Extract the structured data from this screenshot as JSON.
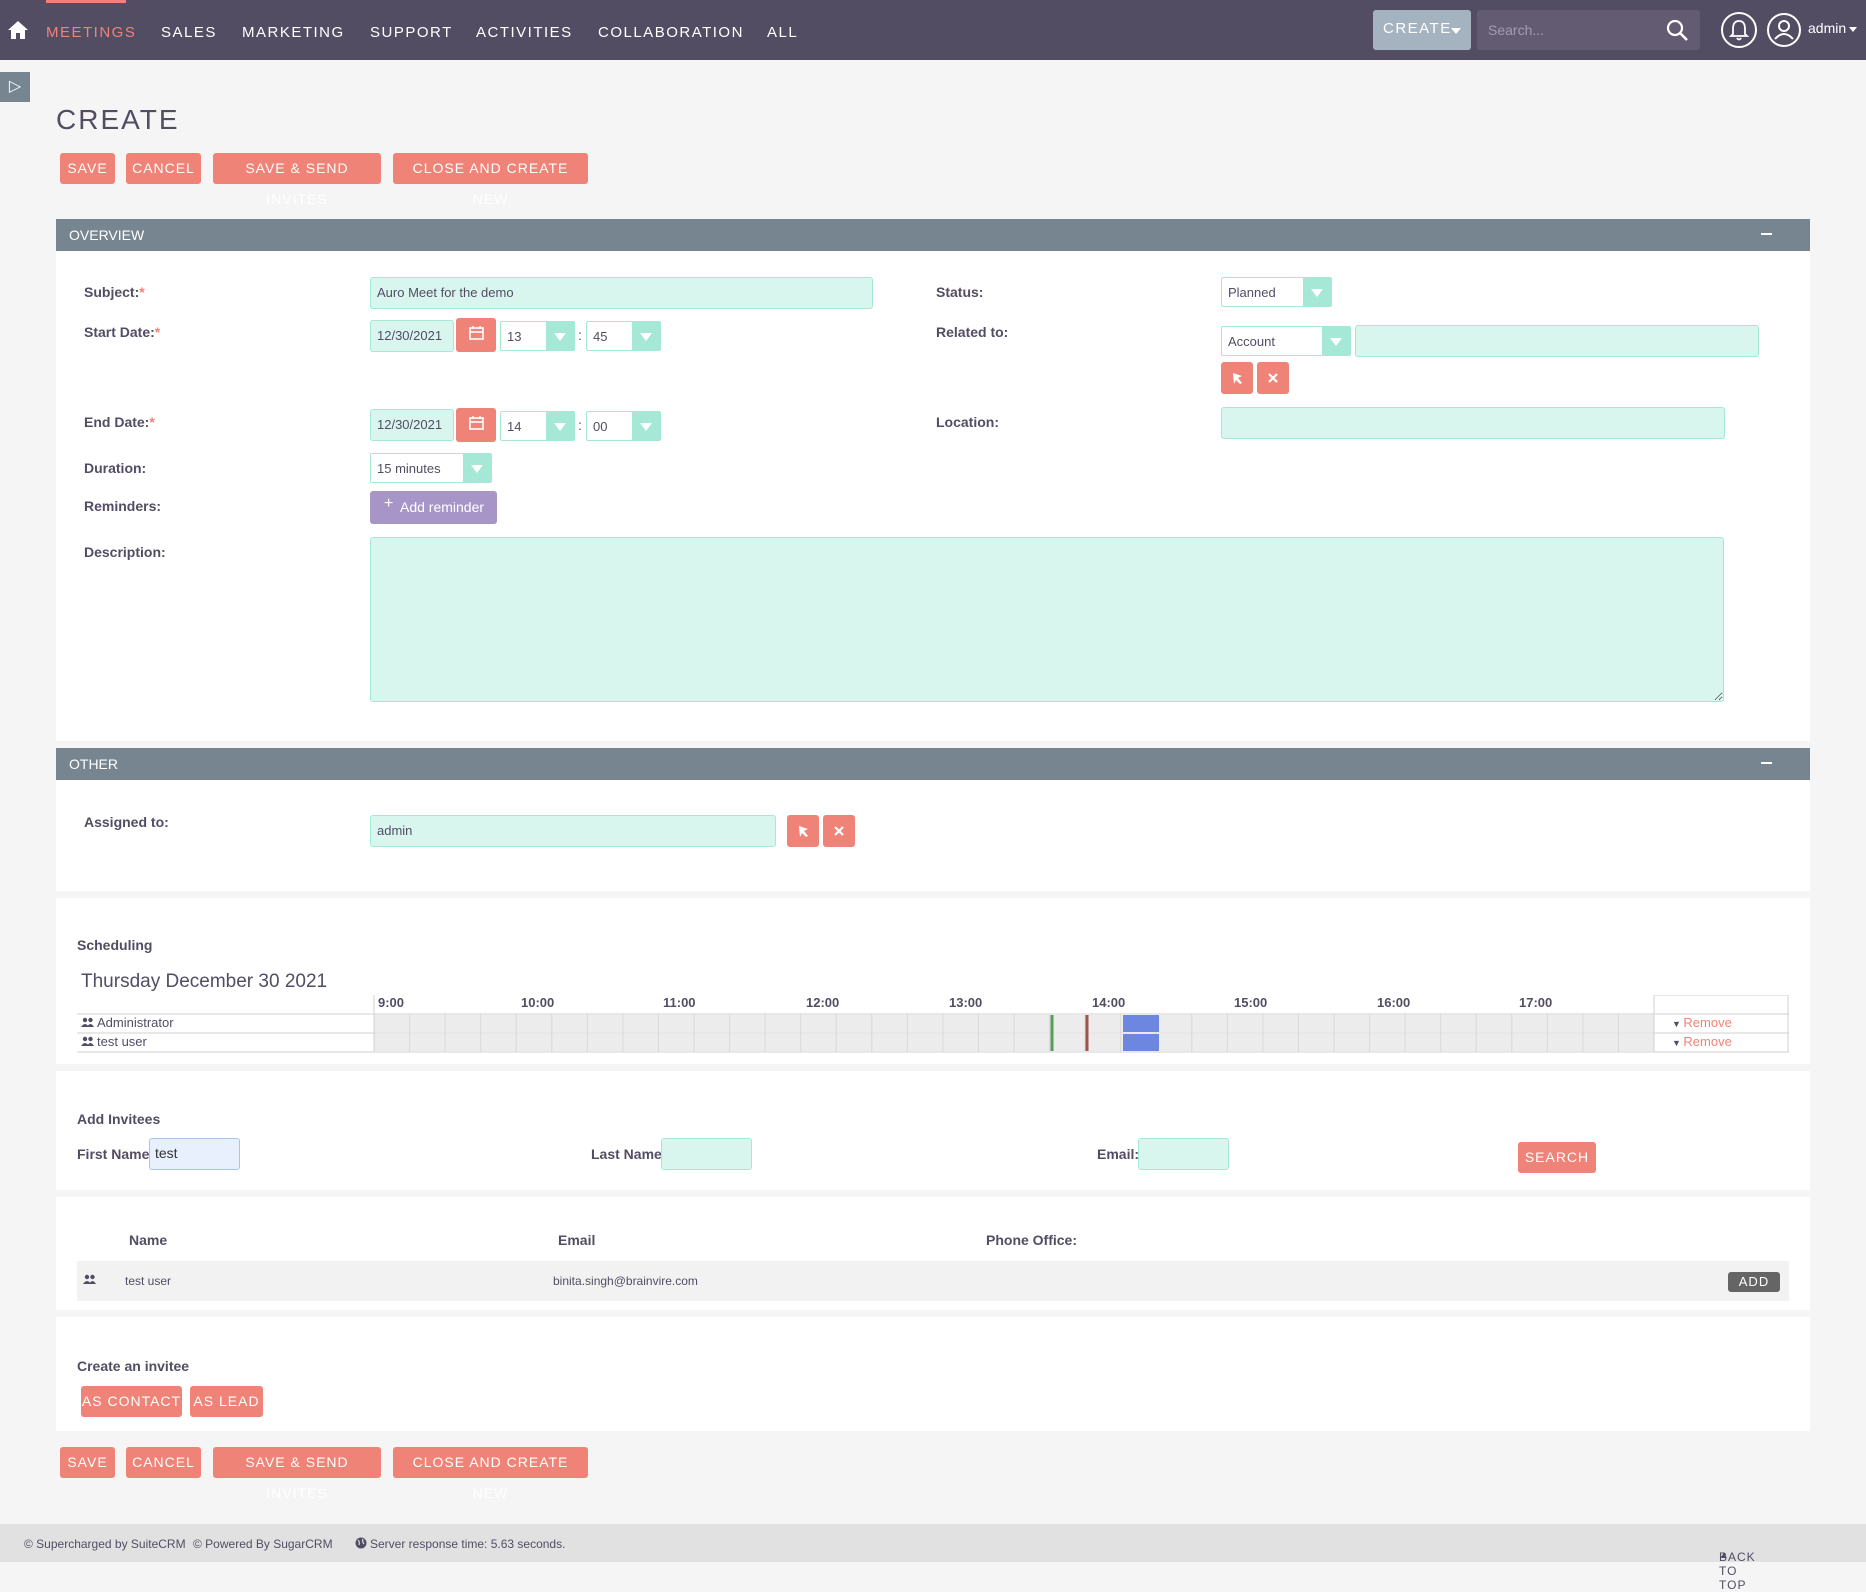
{
  "nav": {
    "items": [
      {
        "label": "MEETINGS",
        "active": true
      },
      {
        "label": "SALES"
      },
      {
        "label": "MARKETING"
      },
      {
        "label": "SUPPORT"
      },
      {
        "label": "ACTIVITIES"
      },
      {
        "label": "COLLABORATION"
      },
      {
        "label": "ALL"
      }
    ],
    "create_label": "CREATE",
    "search_placeholder": "Search...",
    "user": "admin"
  },
  "sidebar_toggle": "▷",
  "page": {
    "title": "CREATE"
  },
  "actions": {
    "save": "SAVE",
    "cancel": "CANCEL",
    "save_send": "SAVE & SEND INVITES",
    "close_new": "CLOSE AND CREATE NEW"
  },
  "overview": {
    "header": "OVERVIEW",
    "subject": {
      "label": "Subject:",
      "value": "Auro Meet for the demo"
    },
    "start_date": {
      "label": "Start Date:",
      "date": "12/30/2021",
      "hour": "13",
      "minute": "45"
    },
    "end_date": {
      "label": "End Date:",
      "date": "12/30/2021",
      "hour": "14",
      "minute": "00"
    },
    "duration": {
      "label": "Duration:",
      "value": "15 minutes"
    },
    "reminders": {
      "label": "Reminders:",
      "button": "Add reminder"
    },
    "description": {
      "label": "Description:",
      "value": ""
    },
    "status": {
      "label": "Status:",
      "value": "Planned"
    },
    "related_to": {
      "label": "Related to:",
      "type": "Account",
      "value": ""
    },
    "location": {
      "label": "Location:",
      "value": ""
    }
  },
  "other": {
    "header": "OTHER",
    "assigned_to": {
      "label": "Assigned to:",
      "value": "admin"
    }
  },
  "scheduling": {
    "title": "Scheduling",
    "date": "Thursday December 30 2021",
    "hours": [
      "9:00",
      "10:00",
      "11:00",
      "12:00",
      "13:00",
      "14:00",
      "15:00",
      "16:00",
      "17:00"
    ],
    "rows": [
      {
        "name": "Administrator",
        "remove": "Remove"
      },
      {
        "name": "test user",
        "remove": "Remove"
      }
    ],
    "colors": {
      "busy": "#6d86e0",
      "start_marker": "#5c9a5c",
      "end_marker": "#a0524a"
    }
  },
  "add_invitees": {
    "title": "Add Invitees",
    "first_name": {
      "label": "First Name:",
      "value": "test"
    },
    "last_name": {
      "label": "Last Name:",
      "value": ""
    },
    "email": {
      "label": "Email:",
      "value": ""
    },
    "search_button": "SEARCH"
  },
  "results": {
    "columns": [
      "Name",
      "Email",
      "Phone Office:"
    ],
    "rows": [
      {
        "name": "test user",
        "email": "binita.singh@brainvire.com",
        "phone": "",
        "action": "ADD"
      }
    ]
  },
  "create_invitee": {
    "title": "Create an invitee",
    "as_contact": "AS CONTACT",
    "as_lead": "AS LEAD"
  },
  "footer": {
    "supercharged": "© Supercharged by SuiteCRM",
    "powered": "© Powered By SugarCRM",
    "server_time": "Server response time: 5.63 seconds.",
    "back_to_top": "BACK TO TOP"
  },
  "colors": {
    "accent": "#f08377",
    "nav_bg": "#534d64",
    "panel_header": "#778591",
    "input_bg": "#d8f5ee"
  }
}
